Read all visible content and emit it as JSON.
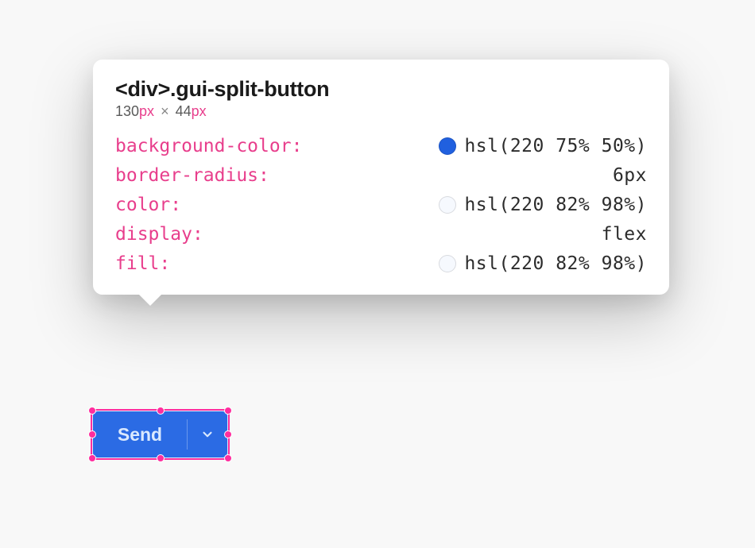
{
  "tooltip": {
    "element_tag": "<div>",
    "element_class": ".gui-split-button",
    "width_value": "130",
    "width_unit": "px",
    "separator": "×",
    "height_value": "44",
    "height_unit": "px",
    "properties": [
      {
        "name": "background-color",
        "value": "hsl(220 75% 50%)",
        "swatch": "hsl(220 75% 50%)"
      },
      {
        "name": "border-radius",
        "value": "6px",
        "swatch": null
      },
      {
        "name": "color",
        "value": "hsl(220 82% 98%)",
        "swatch": "hsl(220 82% 98%)"
      },
      {
        "name": "display",
        "value": "flex",
        "swatch": null
      },
      {
        "name": "fill",
        "value": "hsl(220 82% 98%)",
        "swatch": "hsl(220 82% 98%)"
      }
    ]
  },
  "split_button": {
    "label": "Send",
    "bg_color": "hsl(220 75% 50%)",
    "text_color": "hsl(220 82% 98%)"
  },
  "colors": {
    "selection_pink": "#ff2d9e",
    "property_pink": "#e83e8c"
  }
}
